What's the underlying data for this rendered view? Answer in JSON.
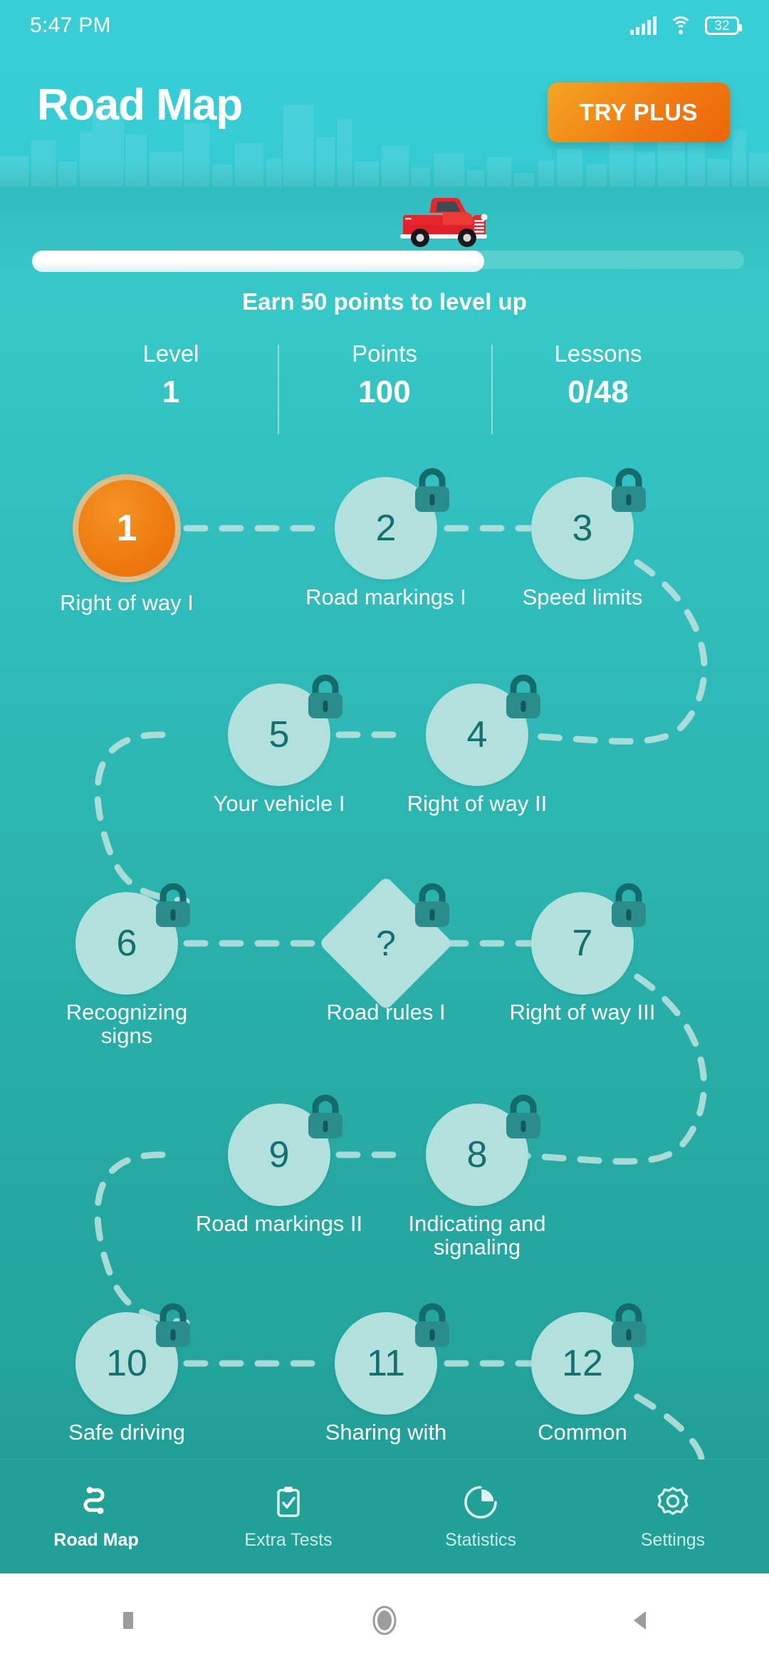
{
  "status_bar": {
    "time": "5:47 PM",
    "battery_level": "32",
    "icons": [
      "signal-icon",
      "wifi-icon",
      "battery-icon"
    ]
  },
  "header": {
    "title": "Road Map",
    "cta_label": "TRY PLUS",
    "cta_color": "#ef7c10"
  },
  "progress": {
    "level_up_text": "Earn 50 points to level up",
    "fill_percent": 63,
    "vehicle_icon": "red-pickup-truck-icon"
  },
  "stats": [
    {
      "label": "Level",
      "value": "1"
    },
    {
      "label": "Points",
      "value": "100"
    },
    {
      "label": "Lessons",
      "value": "0/48"
    }
  ],
  "roadmap": {
    "accent_active": "#ef7c10",
    "node_locked_color": "#b2e0dd",
    "node_number_color": "#14706e",
    "nodes": [
      {
        "number": "1",
        "label": "Right of way I",
        "locked": false,
        "shape": "circle",
        "state": "active"
      },
      {
        "number": "2",
        "label": "Road markings I",
        "locked": true,
        "shape": "circle",
        "state": "locked"
      },
      {
        "number": "3",
        "label": "Speed limits",
        "locked": true,
        "shape": "circle",
        "state": "locked"
      },
      {
        "number": "5",
        "label": "Your vehicle I",
        "locked": true,
        "shape": "circle",
        "state": "locked"
      },
      {
        "number": "4",
        "label": "Right of way II",
        "locked": true,
        "shape": "circle",
        "state": "locked"
      },
      {
        "number": "6",
        "label": "Recognizing\nsigns",
        "locked": true,
        "shape": "circle",
        "state": "locked"
      },
      {
        "number": "?",
        "label": "Road rules I",
        "locked": true,
        "shape": "diamond",
        "state": "locked"
      },
      {
        "number": "7",
        "label": "Right of way III",
        "locked": true,
        "shape": "circle",
        "state": "locked"
      },
      {
        "number": "9",
        "label": "Road markings II",
        "locked": true,
        "shape": "circle",
        "state": "locked"
      },
      {
        "number": "8",
        "label": "Indicating and\nsignaling",
        "locked": true,
        "shape": "circle",
        "state": "locked"
      },
      {
        "number": "10",
        "label": "Safe driving",
        "locked": true,
        "shape": "circle",
        "state": "locked"
      },
      {
        "number": "11",
        "label": "Sharing with",
        "locked": true,
        "shape": "circle",
        "state": "locked"
      },
      {
        "number": "12",
        "label": "Common",
        "locked": true,
        "shape": "circle",
        "state": "locked"
      }
    ]
  },
  "bottom_nav": {
    "items": [
      {
        "label": "Road Map",
        "icon": "road-map-icon",
        "active": true
      },
      {
        "label": "Extra Tests",
        "icon": "clipboard-check-icon",
        "active": false
      },
      {
        "label": "Statistics",
        "icon": "pie-chart-icon",
        "active": false
      },
      {
        "label": "Settings",
        "icon": "gear-icon",
        "active": false
      }
    ]
  },
  "system_nav": {
    "buttons": [
      "recents-square-icon",
      "home-circle-icon",
      "back-triangle-icon"
    ]
  }
}
